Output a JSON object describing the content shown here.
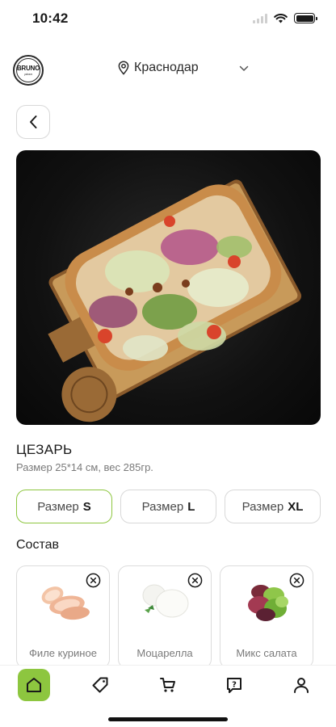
{
  "status_bar": {
    "time": "10:42"
  },
  "header": {
    "logo_text": "BRUNO",
    "logo_sub": "pizza",
    "city": "Краснодар",
    "icons": [
      "location-pin-icon",
      "chevron-down-icon"
    ]
  },
  "product": {
    "title": "ЦЕЗАРЬ",
    "description": "Размер 25*14 см, вес 285гр.",
    "sizes": [
      {
        "label": "Размер",
        "letter": "S",
        "selected": true
      },
      {
        "label": "Размер",
        "letter": "L",
        "selected": false
      },
      {
        "label": "Размер",
        "letter": "XL",
        "selected": false
      }
    ]
  },
  "composition": {
    "title": "Состав",
    "items": [
      {
        "name": "Филе куриное",
        "icon": "chicken-icon"
      },
      {
        "name": "Моцарелла",
        "icon": "mozzarella-icon"
      },
      {
        "name": "Микс салата",
        "icon": "salad-icon"
      }
    ]
  },
  "tab_bar": {
    "tabs": [
      {
        "icon": "home-icon",
        "active": true
      },
      {
        "icon": "tag-icon",
        "active": false
      },
      {
        "icon": "cart-icon",
        "active": false
      },
      {
        "icon": "help-icon",
        "active": false
      },
      {
        "icon": "profile-icon",
        "active": false
      }
    ]
  },
  "colors": {
    "accent": "#8dc63f",
    "text": "#1a1a1a",
    "muted": "#7a7a7a",
    "border": "#d8d8d8"
  }
}
